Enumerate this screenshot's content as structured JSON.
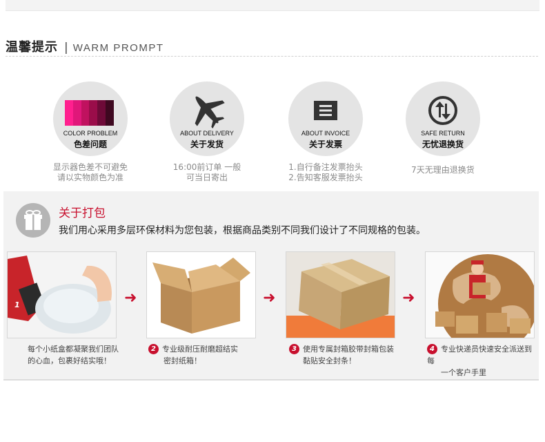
{
  "header": {
    "title_cn": "温馨提示",
    "separator": "|",
    "title_en": "WARM PROMPT"
  },
  "tips": [
    {
      "en": "COLOR PROBLEM",
      "cn": "色差问题",
      "desc": "显示器色差不可避免\n请以实物颜色为准",
      "icon": "color-palette-icon"
    },
    {
      "en": "ABOUT DELIVERY",
      "cn": "关于发货",
      "desc": "16:00前订单 一般\n可当日寄出",
      "icon": "airplane-icon"
    },
    {
      "en": "ABOUT INVOICE",
      "cn": "关于发票",
      "desc": "1.自行备注发票抬头\n2.告知客服发票抬头",
      "icon": "invoice-icon"
    },
    {
      "en": "SAFE RETURN",
      "cn": "无忧退换货",
      "desc": "7天无理由退换货",
      "icon": "return-icon"
    }
  ],
  "palette_colors": [
    "#ff1f8e",
    "#e0177a",
    "#c0125f",
    "#9a0d4a",
    "#6e0a38",
    "#3e0820"
  ],
  "packing": {
    "title": "关于打包",
    "subtitle": "我们用心采用多层环保材料为您包装，根据商品类别不同我们设计了不同规格的包装。",
    "icon": "gift-box-icon",
    "steps": [
      {
        "num": "1",
        "caption_line1": "每个小纸盒都凝聚我们团队",
        "caption_line2": "的心血，包裹好结实哦！",
        "image": "bubble-wrap-photo"
      },
      {
        "num": "2",
        "caption_line1": "专业级耐压耐磨超结实",
        "caption_line2": "密封纸箱！",
        "image": "open-carton-photo"
      },
      {
        "num": "3",
        "caption_line1": "使用专属封箱胶带封箱包装",
        "caption_line2": "黏贴安全封条！",
        "image": "sealed-box-photo"
      },
      {
        "num": "4",
        "caption_line1": "专业快递员快速安全派送到每",
        "caption_line2": "一个客户手里",
        "image": "courier-globe-photo"
      }
    ]
  },
  "colors": {
    "accent": "#c8102e",
    "circle_bg": "#e4e4e4",
    "panel_bg": "#f2f2f2"
  }
}
